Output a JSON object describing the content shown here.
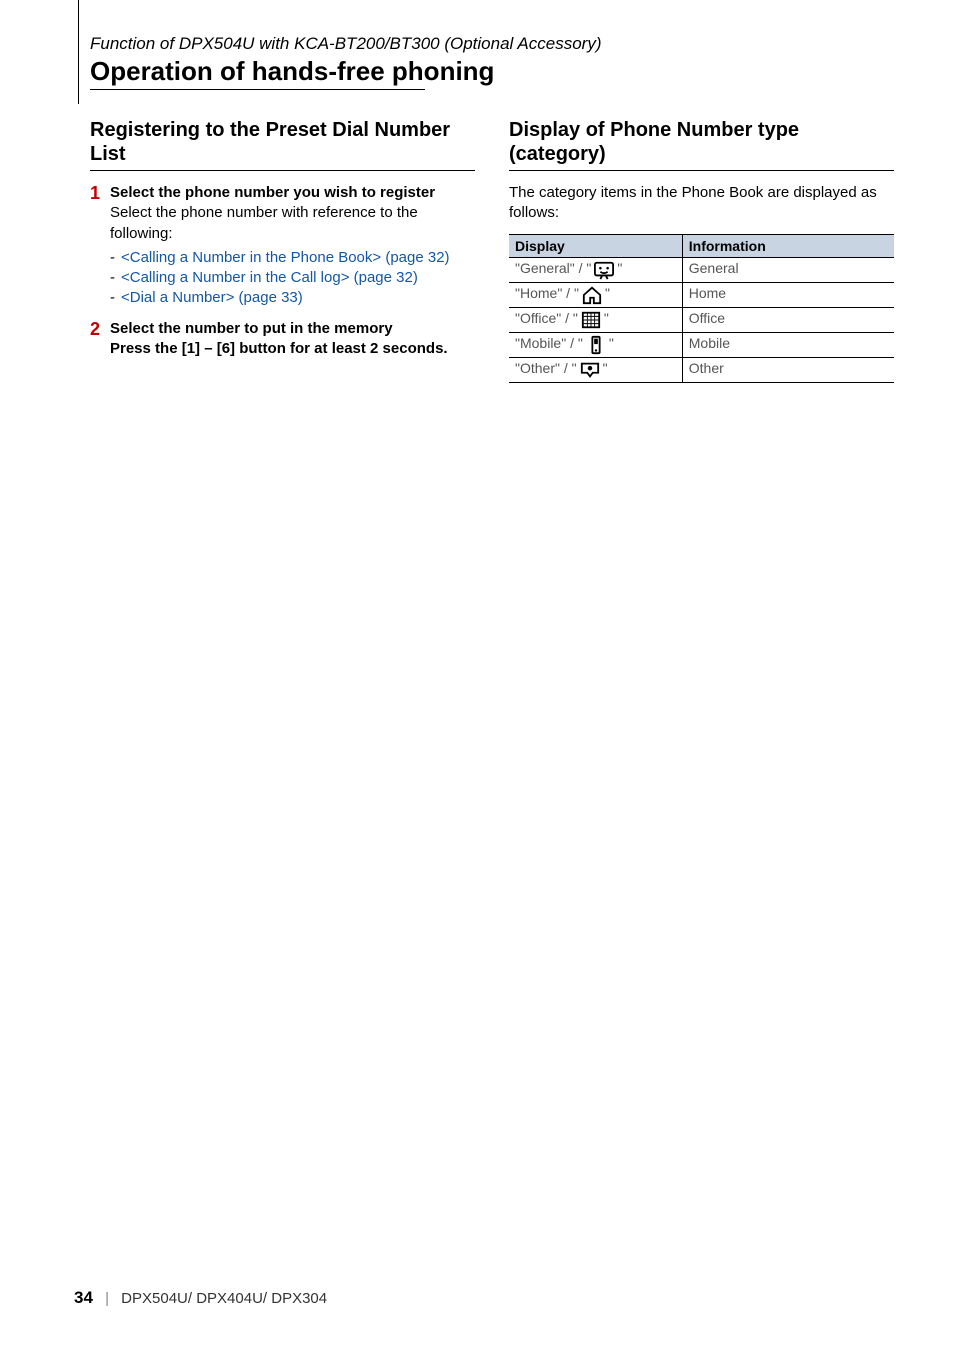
{
  "header": {
    "context": "Function of DPX504U with KCA-BT200/BT300 (Optional Accessory)",
    "title": "Operation of hands-free phoning"
  },
  "left": {
    "heading": "Registering to the Preset Dial Number List",
    "step1": {
      "num": "1",
      "head": "Select the phone number you wish to register",
      "body": "Select the phone number with reference to the following:",
      "links": {
        "a": "<Calling a Number in the Phone Book> (page 32)",
        "b": "<Calling a Number in the Call log> (page 32)",
        "c": "<Dial a Number> (page 33)"
      }
    },
    "step2": {
      "num": "2",
      "head": "Select the number to put in the memory",
      "body": "Press the [1] – [6] button for at least 2 seconds."
    }
  },
  "right": {
    "heading": "Display of Phone Number type (category)",
    "intro": "The category items in the Phone Book are displayed as follows:",
    "table": {
      "h1": "Display",
      "h2": "Information",
      "rows": {
        "r1": {
          "label": "\"General\" / \"",
          "label_end": "\"",
          "info": "General",
          "icon": "general-icon"
        },
        "r2": {
          "label": "\"Home\" / \"",
          "label_end": "\"",
          "info": "Home",
          "icon": "home-icon"
        },
        "r3": {
          "label": "\"Office\" / \"",
          "label_end": "\"",
          "info": "Office",
          "icon": "office-icon"
        },
        "r4": {
          "label": "\"Mobile\" / \"",
          "label_end": "\"",
          "info": "Mobile",
          "icon": "mobile-icon"
        },
        "r5": {
          "label": "\"Other\" / \"",
          "label_end": "\"",
          "info": "Other",
          "icon": "other-icon"
        }
      }
    }
  },
  "footer": {
    "page": "34",
    "sep": "|",
    "models": "DPX504U/ DPX404U/ DPX304"
  }
}
